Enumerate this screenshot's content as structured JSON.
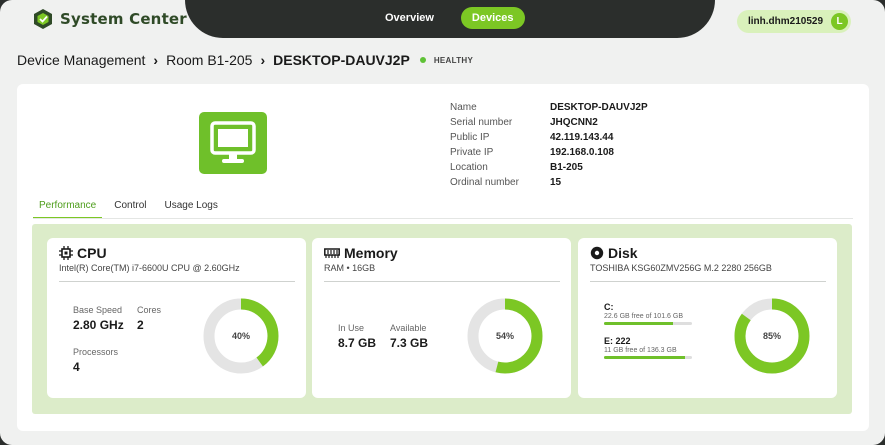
{
  "app": {
    "name": "System Center"
  },
  "nav": {
    "tabs": [
      {
        "label": "Overview",
        "active": false
      },
      {
        "label": "Devices",
        "active": true
      }
    ]
  },
  "user": {
    "name": "linh.dhm210529",
    "initial": "L"
  },
  "breadcrumb": {
    "items": [
      "Device Management",
      "Room B1-205",
      "DESKTOP-DAUVJ2P"
    ],
    "status": "HEALTHY"
  },
  "device": {
    "info": [
      {
        "label": "Name",
        "value": "DESKTOP-DAUVJ2P"
      },
      {
        "label": "Serial number",
        "value": "JHQCNN2"
      },
      {
        "label": "Public IP",
        "value": "42.119.143.44"
      },
      {
        "label": "Private IP",
        "value": "192.168.0.108"
      },
      {
        "label": "Location",
        "value": "B1-205"
      },
      {
        "label": "Ordinal number",
        "value": "15"
      }
    ]
  },
  "tabs": [
    {
      "label": "Performance",
      "active": true
    },
    {
      "label": "Control",
      "active": false
    },
    {
      "label": "Usage Logs",
      "active": false
    }
  ],
  "cpu": {
    "title": "CPU",
    "subtitle": "Intel(R) Core(TM) i7-6600U CPU @ 2.60GHz",
    "base_speed_label": "Base Speed",
    "base_speed": "2.80 GHz",
    "cores_label": "Cores",
    "cores": "2",
    "processors_label": "Processors",
    "processors": "4",
    "usage_label": "40%",
    "usage": 40
  },
  "memory": {
    "title": "Memory",
    "subtitle": "RAM  •  16GB",
    "in_use_label": "In Use",
    "in_use": "8.7 GB",
    "available_label": "Available",
    "available": "7.3 GB",
    "usage_label": "54%",
    "usage": 54
  },
  "disk": {
    "title": "Disk",
    "subtitle": "TOSHIBA KSG60ZMV256G M.2 2280 256GB",
    "drives": [
      {
        "name": "C:",
        "free_text": "22.6 GB free of 101.6 GB",
        "used_fraction": 0.78
      },
      {
        "name": "E: 222",
        "free_text": "11 GB free of 136.3 GB",
        "used_fraction": 0.92
      }
    ],
    "usage_label": "85%",
    "usage": 85
  },
  "colors": {
    "accent": "#7cc724",
    "dark": "#2b2e2c",
    "track": "#e4e4e4",
    "panel": "#dcecc9"
  }
}
